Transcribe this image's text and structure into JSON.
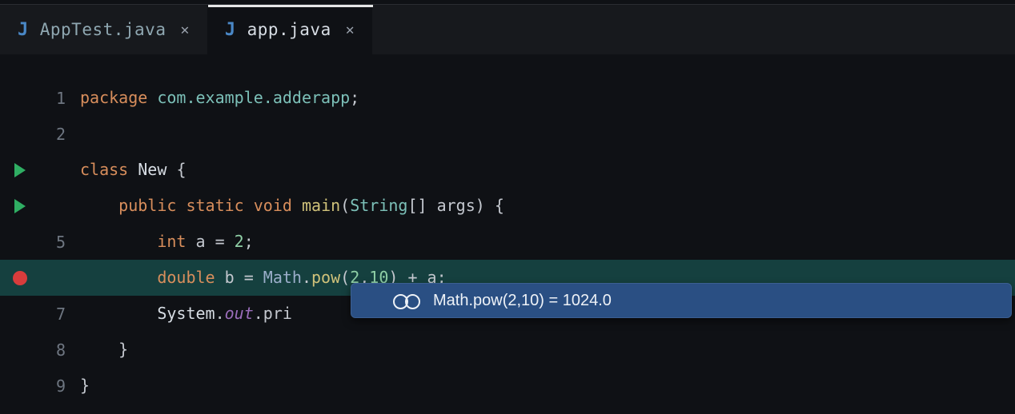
{
  "tabs": [
    {
      "label": "AppTest.java",
      "active": false
    },
    {
      "label": "app.java",
      "active": true
    }
  ],
  "lines": {
    "l1_num": "1",
    "l1_kw_package": "package",
    "l1_pkg": "com.example.adderapp",
    "l1_semi": ";",
    "l2_num": "2",
    "l3_kw_class": "class",
    "l3_name": "New",
    "l3_brace": "{",
    "l4_kw_public": "public",
    "l4_kw_static": "static",
    "l4_kw_void": "void",
    "l4_main": "main",
    "l4_lp": "(",
    "l4_string": "String",
    "l4_brackets": "[]",
    "l4_args": "args",
    "l4_rp_brace": ") {",
    "l5_num": "5",
    "l5_kw_int": "int",
    "l5_rest": " a = ",
    "l5_val": "2",
    "l5_semi": ";",
    "l6_kw_double": "double",
    "l6_assign": " b = ",
    "l6_math": "Math",
    "l6_dot1": ".",
    "l6_pow": "pow",
    "l6_lp": "(",
    "l6_arg1": "2",
    "l6_comma": ",",
    "l6_arg2": "10",
    "l6_rp": ")",
    "l6_plus": " + a",
    "l6_semi": ";",
    "l7_num": "7",
    "l7_system": "System",
    "l7_dot1": ".",
    "l7_out": "out",
    "l7_dot2": ".",
    "l7_pri": "pri",
    "l8_num": "8",
    "l8_brace": "}",
    "l9_num": "9",
    "l9_brace": "}"
  },
  "tooltip": {
    "text": "Math.pow(2,10) = 1024.0"
  }
}
